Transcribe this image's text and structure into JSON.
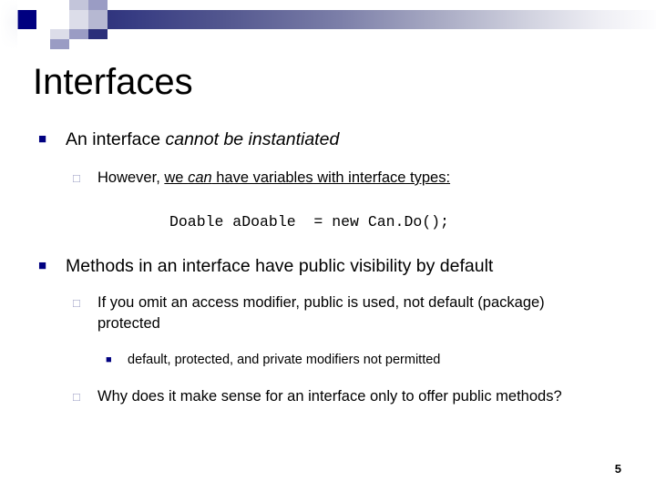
{
  "slide": {
    "title": "Interfaces",
    "page_number": "5",
    "theme": {
      "accent_navy": "#000080",
      "gradient_start": "#2b2f7a",
      "gradient_end": "#fdfdfe",
      "sub_bullet_color": "#9698c0"
    },
    "decor": {
      "gradient_bar_name": "header-gradient-bar",
      "squares_name": "header-square-motif"
    },
    "bullets": [
      {
        "level": 1,
        "marker": "■",
        "marker_name": "bullet-square-filled",
        "parts": [
          {
            "text": "An interface ",
            "style": "normal"
          },
          {
            "text": "cannot be instantiated",
            "style": "italic"
          }
        ]
      },
      {
        "level": 2,
        "marker": "□",
        "marker_name": "bullet-square-hollow",
        "parts": [
          {
            "text": "However, ",
            "style": "normal"
          },
          {
            "text": "we ",
            "style": "underline"
          },
          {
            "text": "can",
            "style": "italic-underline"
          },
          {
            "text": " have variables with interface types:",
            "style": "underline"
          }
        ]
      },
      {
        "level": "code",
        "marker": "",
        "marker_name": "code-sample",
        "code": "Doable aDoable  = new Can.Do();"
      },
      {
        "level": 1,
        "marker": "■",
        "marker_name": "bullet-square-filled",
        "parts": [
          {
            "text": "Methods in an interface have public visibility by default",
            "style": "normal"
          }
        ]
      },
      {
        "level": 2,
        "marker": "□",
        "marker_name": "bullet-square-hollow",
        "parts": [
          {
            "text": "If you omit an access modifier, public is used, not default (package) protected",
            "style": "normal"
          }
        ]
      },
      {
        "level": 3,
        "marker": "■",
        "marker_name": "bullet-square-filled-small",
        "parts": [
          {
            "text": "default, protected, and private modifiers not permitted",
            "style": "normal"
          }
        ]
      },
      {
        "level": 2,
        "marker": "□",
        "marker_name": "bullet-square-hollow",
        "parts": [
          {
            "text": "Why does it make sense for an interface only to offer public methods?",
            "style": "normal"
          }
        ]
      }
    ]
  }
}
